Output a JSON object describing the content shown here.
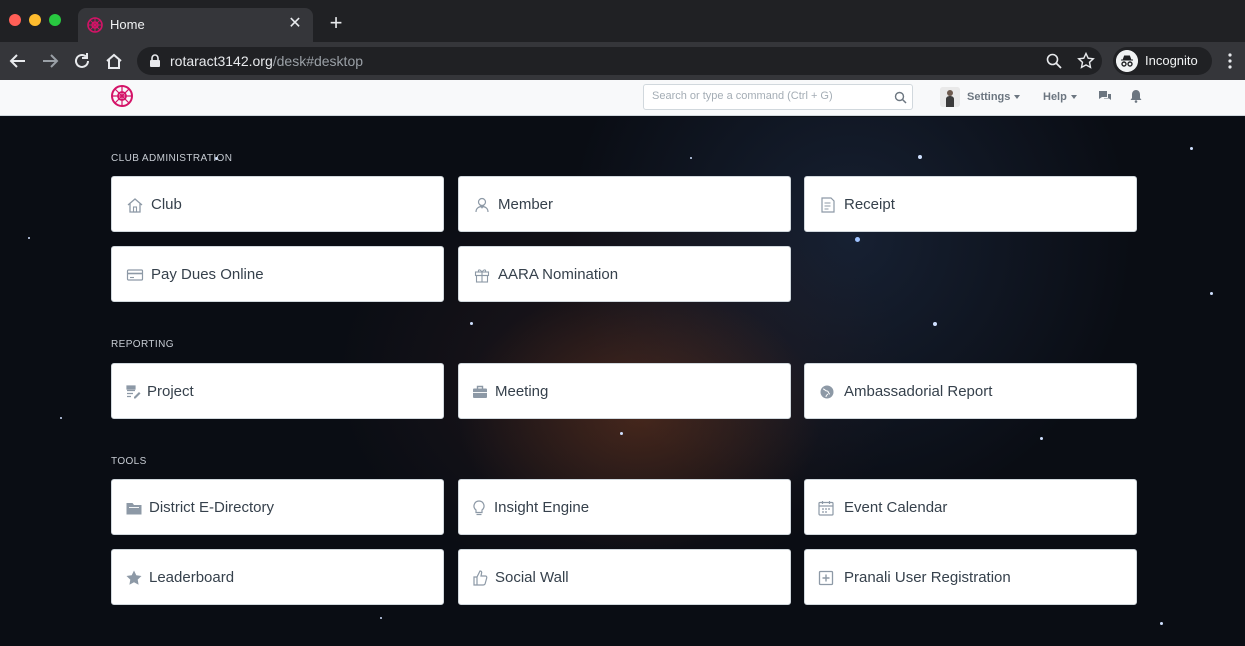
{
  "browser": {
    "tab_title": "Home",
    "url_host": "rotaract3142.org",
    "url_path": "/desk#desktop",
    "profile_label": "Incognito"
  },
  "app_nav": {
    "search_placeholder": "Search or type a command (Ctrl + G)",
    "settings_label": "Settings",
    "help_label": "Help"
  },
  "sections": [
    {
      "title": "CLUB ADMINISTRATION",
      "cards": [
        {
          "label": "Club",
          "icon": "home-icon"
        },
        {
          "label": "Member",
          "icon": "member-icon"
        },
        {
          "label": "Receipt",
          "icon": "receipt-icon"
        },
        {
          "label": "Pay Dues Online",
          "icon": "credit-card-icon"
        },
        {
          "label": "AARA Nomination",
          "icon": "gift-icon"
        }
      ]
    },
    {
      "title": "REPORTING",
      "cards": [
        {
          "label": "Project",
          "icon": "edit-icon"
        },
        {
          "label": "Meeting",
          "icon": "briefcase-icon"
        },
        {
          "label": "Ambassadorial Report",
          "icon": "globe-icon"
        }
      ]
    },
    {
      "title": "TOOLS",
      "cards": [
        {
          "label": "District E-Directory",
          "icon": "folder-icon"
        },
        {
          "label": "Insight Engine",
          "icon": "lightbulb-icon"
        },
        {
          "label": "Event Calendar",
          "icon": "calendar-icon"
        },
        {
          "label": "Leaderboard",
          "icon": "star-icon"
        },
        {
          "label": "Social Wall",
          "icon": "thumbs-up-icon"
        },
        {
          "label": "Pranali User Registration",
          "icon": "plus-square-icon"
        }
      ]
    }
  ],
  "colors": {
    "card_text": "#36414c",
    "icon_gray": "#8d99a6",
    "brand": "#d41367"
  }
}
